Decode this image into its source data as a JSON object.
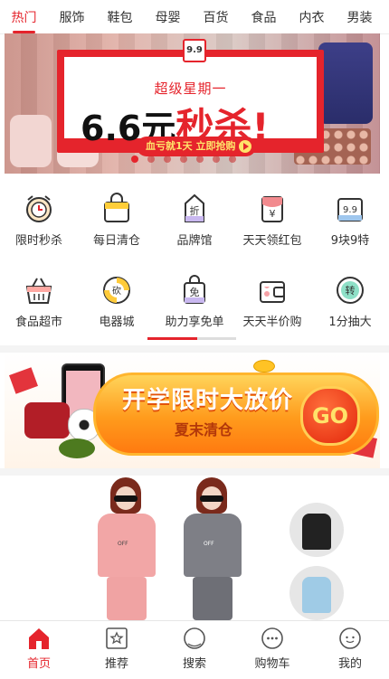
{
  "tabs": [
    {
      "label": "热门",
      "active": true
    },
    {
      "label": "服饰"
    },
    {
      "label": "鞋包"
    },
    {
      "label": "母婴"
    },
    {
      "label": "百货"
    },
    {
      "label": "食品"
    },
    {
      "label": "内衣"
    },
    {
      "label": "男装"
    }
  ],
  "hero": {
    "calendar": "9.9",
    "subtitle": "超级星期一",
    "price": "6.6元",
    "headline": "秒杀!",
    "cta": "血亏就1天 立即抢购",
    "slides": 7,
    "active_slide": 0
  },
  "grid_row1": [
    {
      "label": "限时秒杀",
      "icon": "alarm-clock-icon"
    },
    {
      "label": "每日清仓",
      "icon": "shopping-bag-icon"
    },
    {
      "label": "品牌馆",
      "icon": "discount-tag-icon",
      "glyph": "折"
    },
    {
      "label": "天天领红包",
      "icon": "red-envelope-icon",
      "glyph": "¥"
    },
    {
      "label": "9块9特",
      "icon": "calendar-99-icon",
      "glyph": "9.9"
    }
  ],
  "grid_row2": [
    {
      "label": "食品超市",
      "icon": "basket-icon"
    },
    {
      "label": "电器城",
      "icon": "appliance-badge-icon",
      "glyph": "砍"
    },
    {
      "label": "助力享免单",
      "icon": "free-bag-icon",
      "glyph": "免"
    },
    {
      "label": "天天半价购",
      "icon": "wallet-icon"
    },
    {
      "label": "1分抽大",
      "icon": "spin-icon",
      "glyph": "转"
    }
  ],
  "sale_banner": {
    "title": "开学限时大放价",
    "subtitle": "夏末清仓",
    "go": "GO"
  },
  "products": {
    "logo1": "OFF",
    "logo2": "OFF"
  },
  "nav": [
    {
      "label": "首页",
      "icon": "home-icon",
      "active": true
    },
    {
      "label": "推荐",
      "icon": "star-box-icon"
    },
    {
      "label": "搜索",
      "icon": "search-icon"
    },
    {
      "label": "购物车",
      "icon": "cart-chat-icon"
    },
    {
      "label": "我的",
      "icon": "profile-face-icon"
    }
  ],
  "colors": {
    "accent": "#e5242c",
    "orange": "#ff9b1c"
  }
}
